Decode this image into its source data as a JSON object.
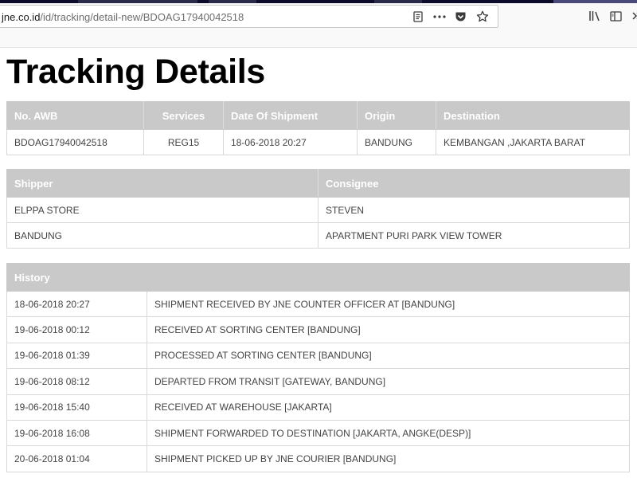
{
  "browser": {
    "url_domain": "jne.co.id",
    "url_path": "/id/tracking/detail-new/BDOAG17940042518"
  },
  "page": {
    "title": "Tracking Details"
  },
  "shipment_table": {
    "headers": [
      "No. AWB",
      "Services",
      "Date Of Shipment",
      "Origin",
      "Destination"
    ],
    "row": [
      "BDOAG17940042518",
      "REG15",
      "18-06-2018 20:27",
      "BANDUNG",
      "KEMBANGAN ,JAKARTA BARAT"
    ]
  },
  "parties_table": {
    "headers": [
      "Shipper",
      "Consignee"
    ],
    "rows": [
      [
        "ELPPA STORE",
        "STEVEN"
      ],
      [
        "BANDUNG",
        "APARTMENT PURI PARK VIEW TOWER"
      ]
    ]
  },
  "history_table": {
    "header": "History",
    "rows": [
      [
        "18-06-2018 20:27",
        "SHIPMENT RECEIVED BY JNE COUNTER OFFICER AT [BANDUNG]"
      ],
      [
        "19-06-2018 00:12",
        "RECEIVED AT SORTING CENTER [BANDUNG]"
      ],
      [
        "19-06-2018 01:39",
        "PROCESSED AT SORTING CENTER [BANDUNG]"
      ],
      [
        "19-06-2018 08:12",
        "DEPARTED FROM TRANSIT [GATEWAY, BANDUNG]"
      ],
      [
        "19-06-2018 15:40",
        "RECEIVED AT WAREHOUSE [JAKARTA]"
      ],
      [
        "19-06-2018 16:08",
        "SHIPMENT FORWARDED TO DESTINATION [JAKARTA, ANGKE(DESP)]"
      ],
      [
        "20-06-2018 01:04",
        "SHIPMENT PICKED UP BY JNE COURIER [BANDUNG]"
      ]
    ]
  },
  "colors": {
    "header_bg": "#c9c9c9",
    "header_text": "#ffffff",
    "cell_text": "#444444",
    "border": "#d8d8d8"
  }
}
